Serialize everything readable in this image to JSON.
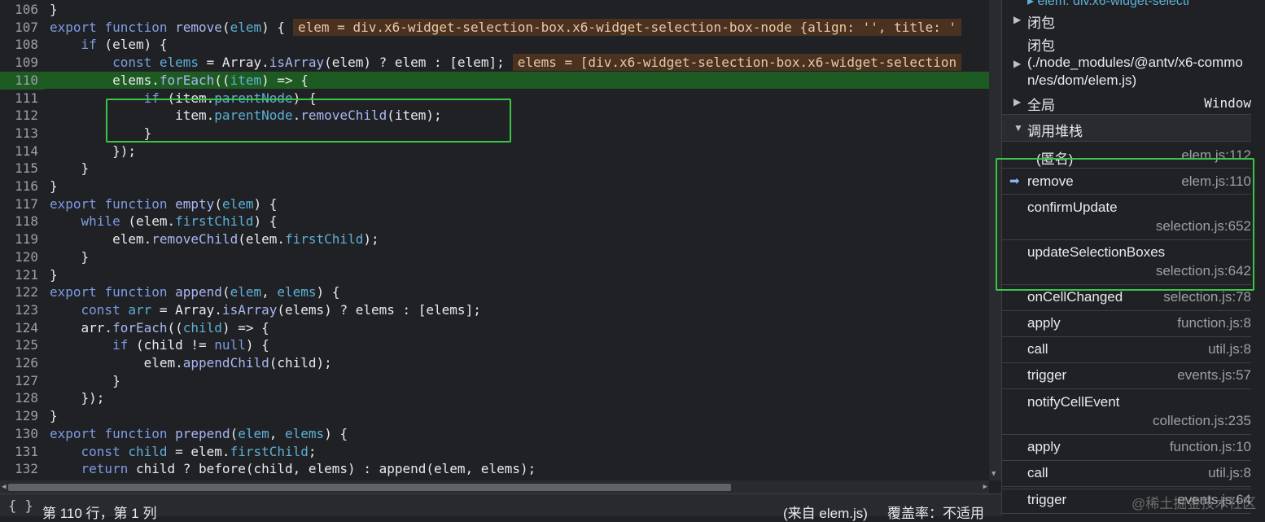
{
  "editor": {
    "lines": [
      {
        "num": "106",
        "tokens": [
          [
            "nm",
            "}"
          ]
        ]
      },
      {
        "num": "107",
        "tokens": [
          [
            "kw",
            "export "
          ],
          [
            "kw",
            "function "
          ],
          [
            "fn",
            "remove"
          ],
          [
            "nm",
            "("
          ],
          [
            "var",
            "elem"
          ],
          [
            "nm",
            ") {"
          ]
        ],
        "inline": "elem = div.x6-widget-selection-box.x6-widget-selection-box-node {align: '', title: '"
      },
      {
        "num": "108",
        "tokens": [
          [
            "nm",
            "    "
          ],
          [
            "kw",
            "if"
          ],
          [
            "nm",
            " (elem) {"
          ]
        ]
      },
      {
        "num": "109",
        "tokens": [
          [
            "nm",
            "        "
          ],
          [
            "kw",
            "const "
          ],
          [
            "var",
            "elems"
          ],
          [
            "nm",
            " = Array."
          ],
          [
            "fn",
            "isArray"
          ],
          [
            "nm",
            "(elem) ? elem : [elem];"
          ]
        ],
        "inline": "elems = [div.x6-widget-selection-box.x6-widget-selection"
      },
      {
        "num": "110",
        "tokens": [
          [
            "nm",
            "        elems."
          ],
          [
            "fn",
            "forEach"
          ],
          [
            "nm",
            "(("
          ],
          [
            "var",
            "item"
          ],
          [
            "nm",
            ") => {"
          ]
        ],
        "current": true
      },
      {
        "num": "111",
        "tokens": [
          [
            "nm",
            "            "
          ],
          [
            "kw",
            "if"
          ],
          [
            "nm",
            " (item."
          ],
          [
            "prop",
            "parentNode"
          ],
          [
            "nm",
            ") {"
          ]
        ]
      },
      {
        "num": "112",
        "tokens": [
          [
            "nm",
            "                item."
          ],
          [
            "prop",
            "parentNode"
          ],
          [
            "nm",
            "."
          ],
          [
            "fn",
            "removeChild"
          ],
          [
            "nm",
            "(item);"
          ]
        ]
      },
      {
        "num": "113",
        "tokens": [
          [
            "nm",
            "            }"
          ]
        ]
      },
      {
        "num": "114",
        "tokens": [
          [
            "nm",
            "        });"
          ]
        ]
      },
      {
        "num": "115",
        "tokens": [
          [
            "nm",
            "    }"
          ]
        ]
      },
      {
        "num": "116",
        "tokens": [
          [
            "nm",
            "}"
          ]
        ]
      },
      {
        "num": "117",
        "tokens": [
          [
            "kw",
            "export "
          ],
          [
            "kw",
            "function "
          ],
          [
            "fn",
            "empty"
          ],
          [
            "nm",
            "("
          ],
          [
            "var",
            "elem"
          ],
          [
            "nm",
            ") {"
          ]
        ]
      },
      {
        "num": "118",
        "tokens": [
          [
            "nm",
            "    "
          ],
          [
            "kw",
            "while"
          ],
          [
            "nm",
            " (elem."
          ],
          [
            "prop",
            "firstChild"
          ],
          [
            "nm",
            ") {"
          ]
        ]
      },
      {
        "num": "119",
        "tokens": [
          [
            "nm",
            "        elem."
          ],
          [
            "fn",
            "removeChild"
          ],
          [
            "nm",
            "(elem."
          ],
          [
            "prop",
            "firstChild"
          ],
          [
            "nm",
            ");"
          ]
        ]
      },
      {
        "num": "120",
        "tokens": [
          [
            "nm",
            "    }"
          ]
        ]
      },
      {
        "num": "121",
        "tokens": [
          [
            "nm",
            "}"
          ]
        ]
      },
      {
        "num": "122",
        "tokens": [
          [
            "kw",
            "export "
          ],
          [
            "kw",
            "function "
          ],
          [
            "fn",
            "append"
          ],
          [
            "nm",
            "("
          ],
          [
            "var",
            "elem"
          ],
          [
            "nm",
            ", "
          ],
          [
            "var",
            "elems"
          ],
          [
            "nm",
            ") {"
          ]
        ]
      },
      {
        "num": "123",
        "tokens": [
          [
            "nm",
            "    "
          ],
          [
            "kw",
            "const "
          ],
          [
            "var",
            "arr"
          ],
          [
            "nm",
            " = Array."
          ],
          [
            "fn",
            "isArray"
          ],
          [
            "nm",
            "(elems) ? elems : [elems];"
          ]
        ]
      },
      {
        "num": "124",
        "tokens": [
          [
            "nm",
            "    arr."
          ],
          [
            "fn",
            "forEach"
          ],
          [
            "nm",
            "(("
          ],
          [
            "var",
            "child"
          ],
          [
            "nm",
            ") => {"
          ]
        ]
      },
      {
        "num": "125",
        "tokens": [
          [
            "nm",
            "        "
          ],
          [
            "kw",
            "if"
          ],
          [
            "nm",
            " (child != "
          ],
          [
            "kw",
            "null"
          ],
          [
            "nm",
            ") {"
          ]
        ]
      },
      {
        "num": "126",
        "tokens": [
          [
            "nm",
            "            elem."
          ],
          [
            "fn",
            "appendChild"
          ],
          [
            "nm",
            "(child);"
          ]
        ]
      },
      {
        "num": "127",
        "tokens": [
          [
            "nm",
            "        }"
          ]
        ]
      },
      {
        "num": "128",
        "tokens": [
          [
            "nm",
            "    });"
          ]
        ]
      },
      {
        "num": "129",
        "tokens": [
          [
            "nm",
            "}"
          ]
        ]
      },
      {
        "num": "130",
        "tokens": [
          [
            "kw",
            "export "
          ],
          [
            "kw",
            "function "
          ],
          [
            "fn",
            "prepend"
          ],
          [
            "nm",
            "("
          ],
          [
            "var",
            "elem"
          ],
          [
            "nm",
            ", "
          ],
          [
            "var",
            "elems"
          ],
          [
            "nm",
            ") {"
          ]
        ]
      },
      {
        "num": "131",
        "tokens": [
          [
            "nm",
            "    "
          ],
          [
            "kw",
            "const "
          ],
          [
            "var",
            "child"
          ],
          [
            "nm",
            " = elem."
          ],
          [
            "prop",
            "firstChild"
          ],
          [
            "nm",
            ";"
          ]
        ]
      },
      {
        "num": "132",
        "tokens": [
          [
            "nm",
            "    "
          ],
          [
            "kw",
            "return"
          ],
          [
            "nm",
            " child ? before(child, elems) : append(elem, elems);"
          ]
        ]
      }
    ]
  },
  "status": {
    "braces": "{ }",
    "position": "第 110 行，第 1 列",
    "source": "(来自 elem.js)",
    "coverage": "覆盖率：不适用"
  },
  "scope": {
    "top_partial": "▸ elem: div.x6-widget-selecti",
    "items": [
      {
        "label": "闭包",
        "expandable": true
      },
      {
        "label": "闭包",
        "expandable": false
      },
      {
        "label": "(./node_modules/@antv/x6-common/es/dom/elem.js)",
        "expandable": true
      },
      {
        "label": "全局",
        "value": "Window",
        "expandable": true
      }
    ]
  },
  "callstack": {
    "header": "调用堆栈",
    "frames": [
      {
        "name": "(匿名)",
        "loc": "elem.js:112"
      },
      {
        "name": "remove",
        "loc": "elem.js:110",
        "current": true
      },
      {
        "name": "confirmUpdate",
        "loc": "selection.js:652"
      },
      {
        "name": "updateSelectionBoxes",
        "loc": "selection.js:642"
      },
      {
        "name": "onCellChanged",
        "loc": "selection.js:78"
      },
      {
        "name": "apply",
        "loc": "function.js:8"
      },
      {
        "name": "call",
        "loc": "util.js:8"
      },
      {
        "name": "trigger",
        "loc": "events.js:57"
      },
      {
        "name": "notifyCellEvent",
        "loc": "collection.js:235"
      },
      {
        "name": "apply",
        "loc": "function.js:10"
      },
      {
        "name": "call",
        "loc": "util.js:8"
      },
      {
        "name": "trigger",
        "loc": "events.js:64"
      }
    ]
  },
  "watermark": "@稀土掘金技术社区",
  "colors": {
    "current_line": "#1e5b22",
    "highlight_box": "#3ac54a",
    "inline_value_bg": "#4a3120"
  }
}
